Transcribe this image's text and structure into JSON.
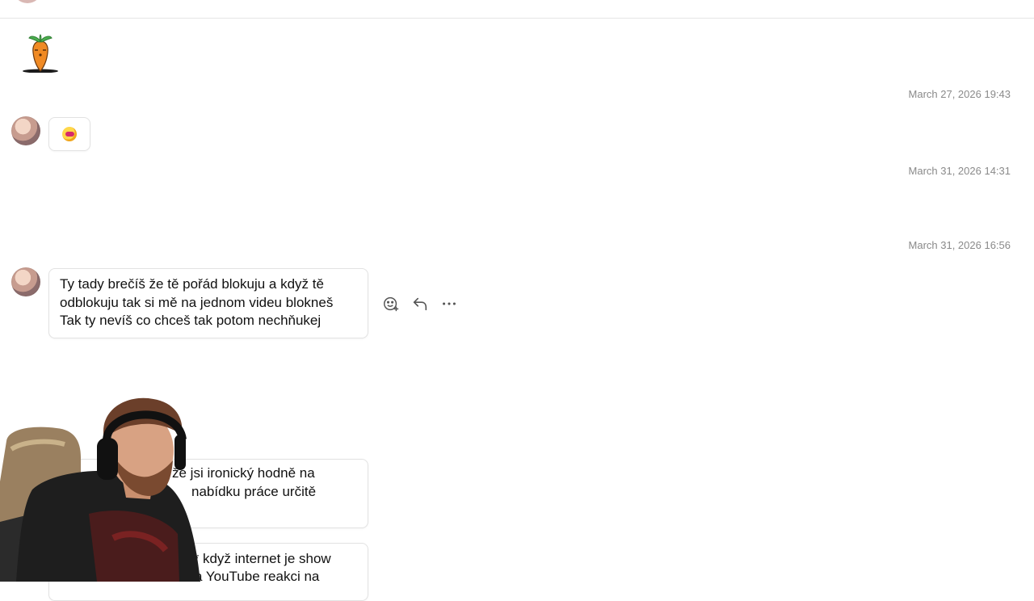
{
  "chat": {
    "timestamps": [
      "March 27, 2026 19:43",
      "March 31, 2026 14:31",
      "March 31, 2026 16:56"
    ],
    "messages": {
      "m1_reaction": "emoji-face",
      "m2": {
        "lines": [
          "Ty tady brečíš že tě pořád blokuju a když tě",
          "odblokuju tak si mě na jednom videu blokneš",
          "Tak ty nevíš co chceš tak potom nechňukej"
        ]
      },
      "m3": {
        "lines": [
          "že jsi ironický hodně na",
          "nabídku práce určitě"
        ]
      },
      "m4": {
        "lines": [
          "** když internet je show",
          "a YouTube reakci na"
        ]
      }
    },
    "actions": {
      "icons": [
        "add-reaction-icon",
        "reply-icon",
        "more-options-icon"
      ]
    }
  },
  "colors": {
    "timestamp": "#8a8a8a",
    "bubble_border": "#e2e2e2",
    "background": "#ffffff"
  }
}
